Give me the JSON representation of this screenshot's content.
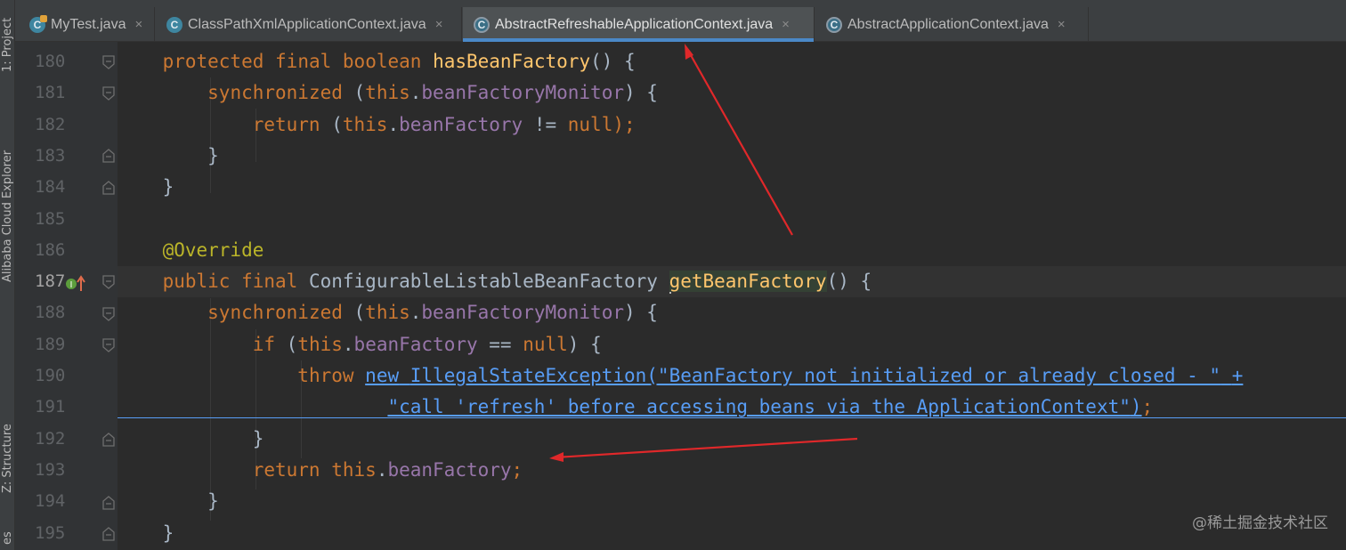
{
  "side_tools": {
    "project": "1: Project",
    "cloud": "Alibaba Cloud Explorer",
    "structure": "Z: Structure",
    "favorites": "es"
  },
  "tabs": [
    {
      "label": "MyTest.java",
      "icon": "java-class-main-icon",
      "active": false
    },
    {
      "label": "ClassPathXmlApplicationContext.java",
      "icon": "java-class-icon",
      "active": false
    },
    {
      "label": "AbstractRefreshableApplicationContext.java",
      "icon": "abstract-class-icon",
      "active": true
    },
    {
      "label": "AbstractApplicationContext.java",
      "icon": "abstract-class-icon",
      "active": false
    }
  ],
  "tab_close_glyph": "×",
  "line_numbers": [
    "180",
    "181",
    "182",
    "183",
    "184",
    "185",
    "186",
    "187",
    "188",
    "189",
    "190",
    "191",
    "192",
    "193",
    "194",
    "195"
  ],
  "code": {
    "l180": {
      "indent": "    ",
      "protected": "protected",
      "final": "final",
      "boolean": "boolean",
      "name": "hasBeanFactory",
      "rest": "() {"
    },
    "l181": {
      "indent": "        ",
      "synchronized": "synchronized",
      "open": " (",
      "this": "this",
      "dot": ".",
      "field": "beanFactoryMonitor",
      "rest": ") {"
    },
    "l182": {
      "indent": "            ",
      "return": "return",
      "open": " (",
      "this": "this",
      "dot": ".",
      "field": "beanFactory",
      "op": " != ",
      "null": "null",
      "rest": ");"
    },
    "l183": {
      "text": "        }"
    },
    "l184": {
      "text": "    }"
    },
    "l186": {
      "indent": "    ",
      "annotation": "@Override"
    },
    "l187": {
      "indent": "    ",
      "public": "public",
      "final": "final",
      "type": "ConfigurableListableBeanFactory",
      "name": "getBeanFactory",
      "rest": "() {"
    },
    "l188": {
      "indent": "        ",
      "synchronized": "synchronized",
      "open": " (",
      "this": "this",
      "dot": ".",
      "field": "beanFactoryMonitor",
      "rest": ") {"
    },
    "l189": {
      "indent": "            ",
      "if": "if",
      "open": " (",
      "this": "this",
      "dot": ".",
      "field": "beanFactory",
      "op": " == ",
      "null": "null",
      "rest": ") {"
    },
    "l190": {
      "indent": "                ",
      "throw": "throw",
      "new": "new",
      "cls": "IllegalStateException(",
      "str": "\"BeanFactory not initialized or already closed - \"",
      "plus": "+"
    },
    "l191": {
      "indent": "                        ",
      "str": "\"call 'refresh' before accessing beans via the ApplicationContext\"",
      "close": ")",
      "semi": ";"
    },
    "l192": {
      "text": "            }"
    },
    "l193": {
      "indent": "            ",
      "return": "return",
      "this": "this",
      "dot": ".",
      "field": "beanFactory",
      "semi": ";"
    },
    "l194": {
      "text": "        }"
    },
    "l195": {
      "text": "    }"
    }
  },
  "watermark": "@稀土掘金技术社区",
  "colors": {
    "keyword": "#cc7832",
    "method": "#ffc66d",
    "field": "#9876aa",
    "annotation": "#bbb529",
    "link": "#589df6",
    "arrow": "#e0282a"
  }
}
